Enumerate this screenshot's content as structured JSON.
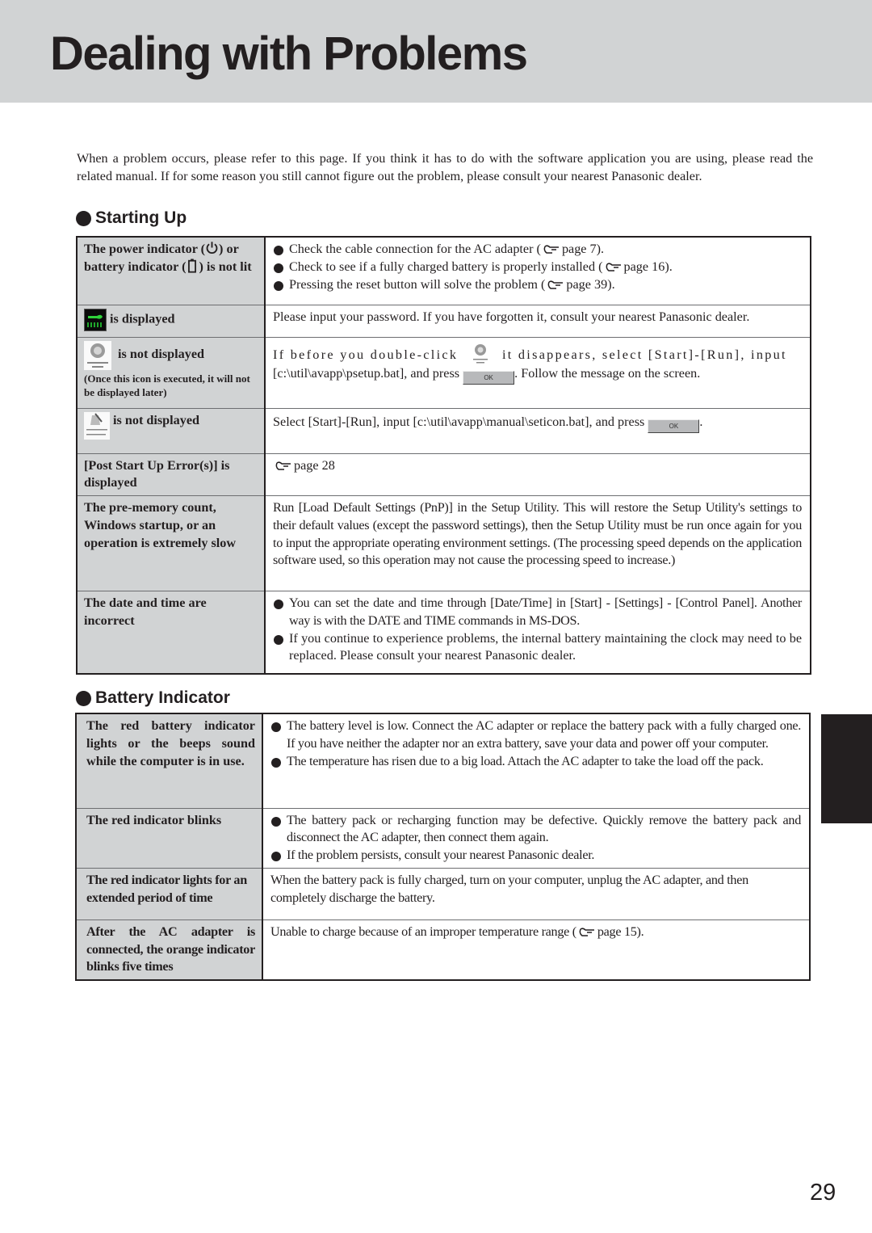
{
  "page": {
    "title": "Dealing with Problems",
    "intro": "When a problem occurs, please refer to this page.  If you think it has to do with the software application you are using, please read the related manual.  If for some reason you still cannot figure out the problem, please consult your nearest Panasonic dealer.",
    "page_number": "29"
  },
  "icons": {
    "reference": "pointing-hand-icon",
    "power": "power-icon",
    "battery": "battery-icon",
    "password_lock": "password-lock-icon",
    "panasonic_setup": "panasonic-setup-icon",
    "manual": "reference-manual-icon",
    "ok_button": "ok-button"
  },
  "starting_up": {
    "heading": "Starting Up",
    "rows": [
      {
        "cond_part1": "The power indicator (",
        "cond_part2": ") or battery indicator (",
        "cond_part3": ") is not lit",
        "bullets": [
          {
            "text": "Check the cable connection for the AC adapter (",
            "ref": "page 7)."
          },
          {
            "text": "Check to see if a fully charged battery is properly installed (",
            "ref": "page 16)."
          },
          {
            "text": "Pressing the reset button will solve the problem (",
            "ref": "page 39)."
          }
        ]
      },
      {
        "cond": "is displayed",
        "solution": "Please input your password.  If you have forgotten it, consult your nearest Panasonic dealer."
      },
      {
        "cond": "is not displayed",
        "note": "(Once this icon is executed,  it will not be displayed later)",
        "sol_part1": "If before you double-click",
        "sol_part2": "it disappears, select [Start]-[Run], input",
        "sol_part3": "[c:\\util\\avapp\\psetup.bat], and press",
        "sol_part4": ". Follow the message on the screen.",
        "ok_label": "OK"
      },
      {
        "cond": "is not displayed",
        "sol_part1": "Select [Start]-[Run], input [c:\\util\\avapp\\manual\\seticon.bat], and press",
        "sol_part2": ".",
        "ok_label": "OK"
      },
      {
        "cond": "[Post Start Up Error(s)] is displayed",
        "ref": "page 28"
      },
      {
        "cond": "The pre-memory count, Windows startup, or an operation is extremely slow",
        "solution": "Run [Load Default Settings (PnP)] in the Setup Utility. This will restore the Setup Utility's settings to their default values (except the password settings), then the Setup Utility must be run once again for you to input the appropriate operating environment settings.  (The processing speed depends on the application software used, so this operation may not cause the processing speed to increase.)"
      },
      {
        "cond": "The date and time are incorrect",
        "bullets": [
          "You can set the date and time through [Date/Time] in [Start] - [Settings] - [Control Panel]. Another way is with the DATE and TIME commands in MS-DOS.",
          "If you continue to experience problems, the internal battery maintaining the clock may need to be replaced.  Please consult your nearest Panasonic dealer."
        ]
      }
    ]
  },
  "battery_indicator": {
    "heading": "Battery Indicator",
    "rows": [
      {
        "cond": "The red battery indicator lights or the beeps sound while the computer is in use.",
        "bullets": [
          "The battery level is low. Connect the AC adapter or replace the battery pack with a fully charged one. If you have neither the adapter nor an extra battery, save your data and power off your computer.",
          "The temperature has risen due to a big load.  Attach the AC adapter to take the load off the pack."
        ]
      },
      {
        "cond": "The red indicator blinks",
        "bullets": [
          "The battery pack or recharging function may be defective.  Quickly remove the battery pack and disconnect the AC adapter, then connect them again.",
          "If the problem persists, consult your nearest Panasonic dealer."
        ]
      },
      {
        "cond": "The red indicator lights for an extended period of time",
        "solution": "When the battery pack is fully charged, turn on your computer, unplug the AC adapter, and then completely discharge the battery."
      },
      {
        "cond": "After the AC adapter is connected, the orange indicator blinks five times",
        "solution": "Unable to charge because of an improper temperature range (",
        "ref": "page 15)."
      }
    ]
  }
}
